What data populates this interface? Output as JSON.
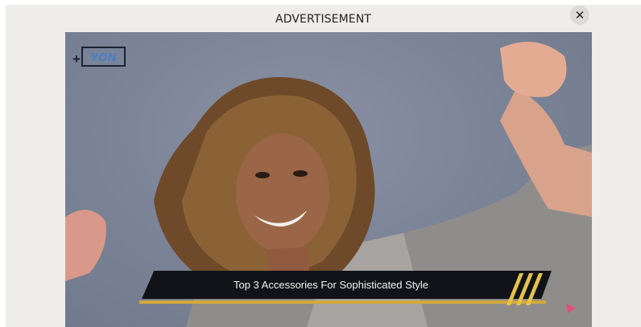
{
  "ad": {
    "label": "ADVERTISEMENT",
    "close_glyph": "✕",
    "close_icon": "close-icon"
  },
  "video": {
    "brand_logo_prefix": "+",
    "brand_logo_text": "YON",
    "caption": "Top 3 Accessories For Sophisticated Style",
    "caption_color": "#111318",
    "accent_color": "#d2a93a"
  }
}
